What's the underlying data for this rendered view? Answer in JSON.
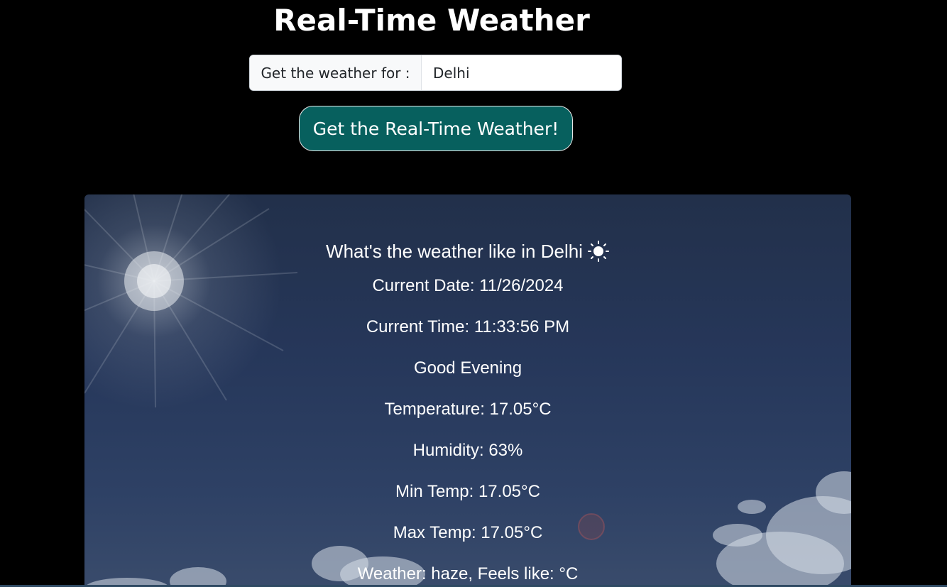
{
  "header": {
    "title": "Real-Time Weather"
  },
  "search": {
    "label": "Get the weather for :",
    "value": "Delhi",
    "button_label": "Get the Real-Time Weather!"
  },
  "weather": {
    "heading": "What's the weather like in Delhi",
    "icon": "sun-icon",
    "current_date": "Current Date: 11/26/2024",
    "current_time": "Current Time: 11:33:56 PM",
    "greeting": "Good Evening",
    "temperature": "Temperature: 17.05°C",
    "humidity": "Humidity: 63%",
    "min_temp": "Min Temp: 17.05°C",
    "max_temp": "Max Temp: 17.05°C",
    "description": "Weather: haze, Feels like: °C"
  },
  "colors": {
    "background": "#000000",
    "button": "#07605e",
    "text": "#ffffff"
  }
}
